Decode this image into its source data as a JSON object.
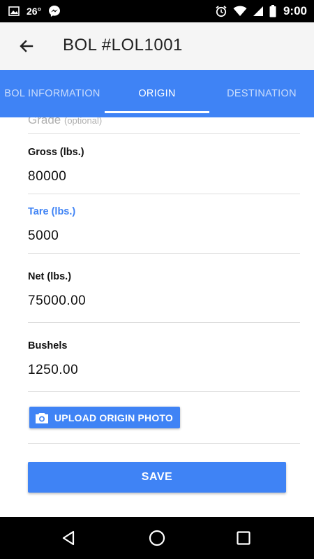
{
  "status_bar": {
    "temperature": "26°",
    "time": "9:00",
    "icons": [
      "image-icon",
      "messenger-icon",
      "alarm-icon",
      "wifi-icon",
      "signal-icon",
      "battery-icon"
    ]
  },
  "app_bar": {
    "back_icon": "arrow-left-icon",
    "title": "BOL #LOL1001"
  },
  "tabs": [
    {
      "label": "BOL INFORMATION",
      "active": false
    },
    {
      "label": "ORIGIN",
      "active": true
    },
    {
      "label": "DESTINATION",
      "active": false
    }
  ],
  "form": {
    "grade": {
      "placeholder": "Grade",
      "hint": "(optional)"
    },
    "gross": {
      "label": "Gross (lbs.)",
      "value": "80000"
    },
    "tare": {
      "label": "Tare (lbs.)",
      "value": "5000"
    },
    "net": {
      "label": "Net (lbs.)",
      "value": "75000.00"
    },
    "bushels": {
      "label": "Bushels",
      "value": "1250.00"
    },
    "upload_button": {
      "label": "UPLOAD ORIGIN PHOTO",
      "icon": "camera-icon"
    },
    "save_button": {
      "label": "SAVE"
    }
  },
  "nav_bar": {
    "icons": [
      "back-triangle-icon",
      "home-circle-icon",
      "recents-square-icon"
    ]
  },
  "colors": {
    "accent": "#3f83f5",
    "status_bar": "#000000",
    "app_bar": "#f5f5f5"
  }
}
